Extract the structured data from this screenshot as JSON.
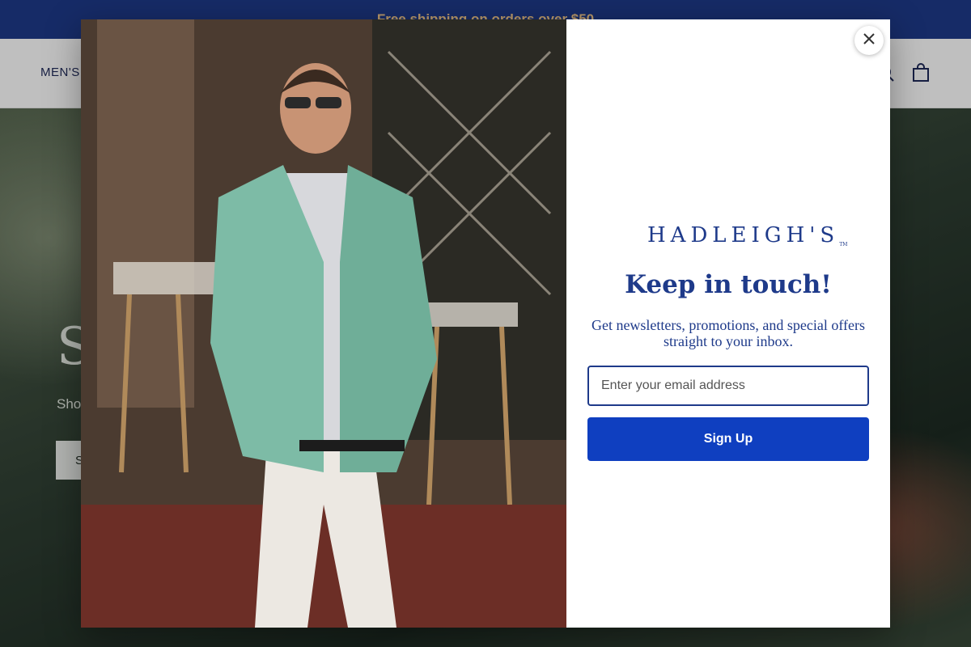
{
  "announcement": {
    "text": "Free shipping on orders over $50"
  },
  "header": {
    "nav": [
      {
        "label": "MEN'S"
      }
    ],
    "icons": [
      "search-icon",
      "cart-icon"
    ]
  },
  "hero": {
    "title": "S",
    "subtitle": "Sho",
    "button_label": "S"
  },
  "modal": {
    "brand": "HADLEIGH'S",
    "brand_mark": "TM",
    "headline": "Keep in touch!",
    "blurb": "Get newsletters, promotions, and special offers straight to your inbox.",
    "email_placeholder": "Enter your email address",
    "signup_label": "Sign Up",
    "close_icon": "close-icon"
  },
  "colors": {
    "brand_navy": "#1e3a8a",
    "button_blue": "#0f3fc0",
    "announce_text": "#f3c98c"
  }
}
